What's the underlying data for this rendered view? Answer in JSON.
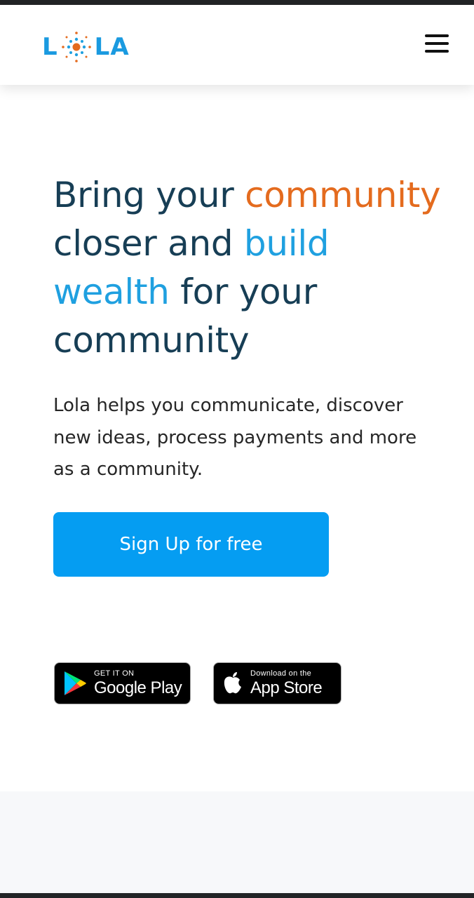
{
  "brand": {
    "logo_left": "L",
    "logo_right": "LA",
    "accent_blue": "#1fa0e0",
    "accent_orange": "#e46b1e"
  },
  "header": {
    "menu_icon": "hamburger-menu-icon"
  },
  "hero": {
    "headline_part1": "Bring your ",
    "headline_highlight1": "community",
    "headline_part2": " closer and ",
    "headline_highlight2": "build wealth",
    "headline_part3": " for your community",
    "description": "Lola helps you communicate, discover new ideas, process payments and more as a community.",
    "cta_label": "Sign Up for free",
    "cta_color": "#059df2"
  },
  "stores": {
    "google_small": "GET IT ON",
    "google_big": "Google Play",
    "apple_small": "Download on the",
    "apple_big": "App Store"
  }
}
